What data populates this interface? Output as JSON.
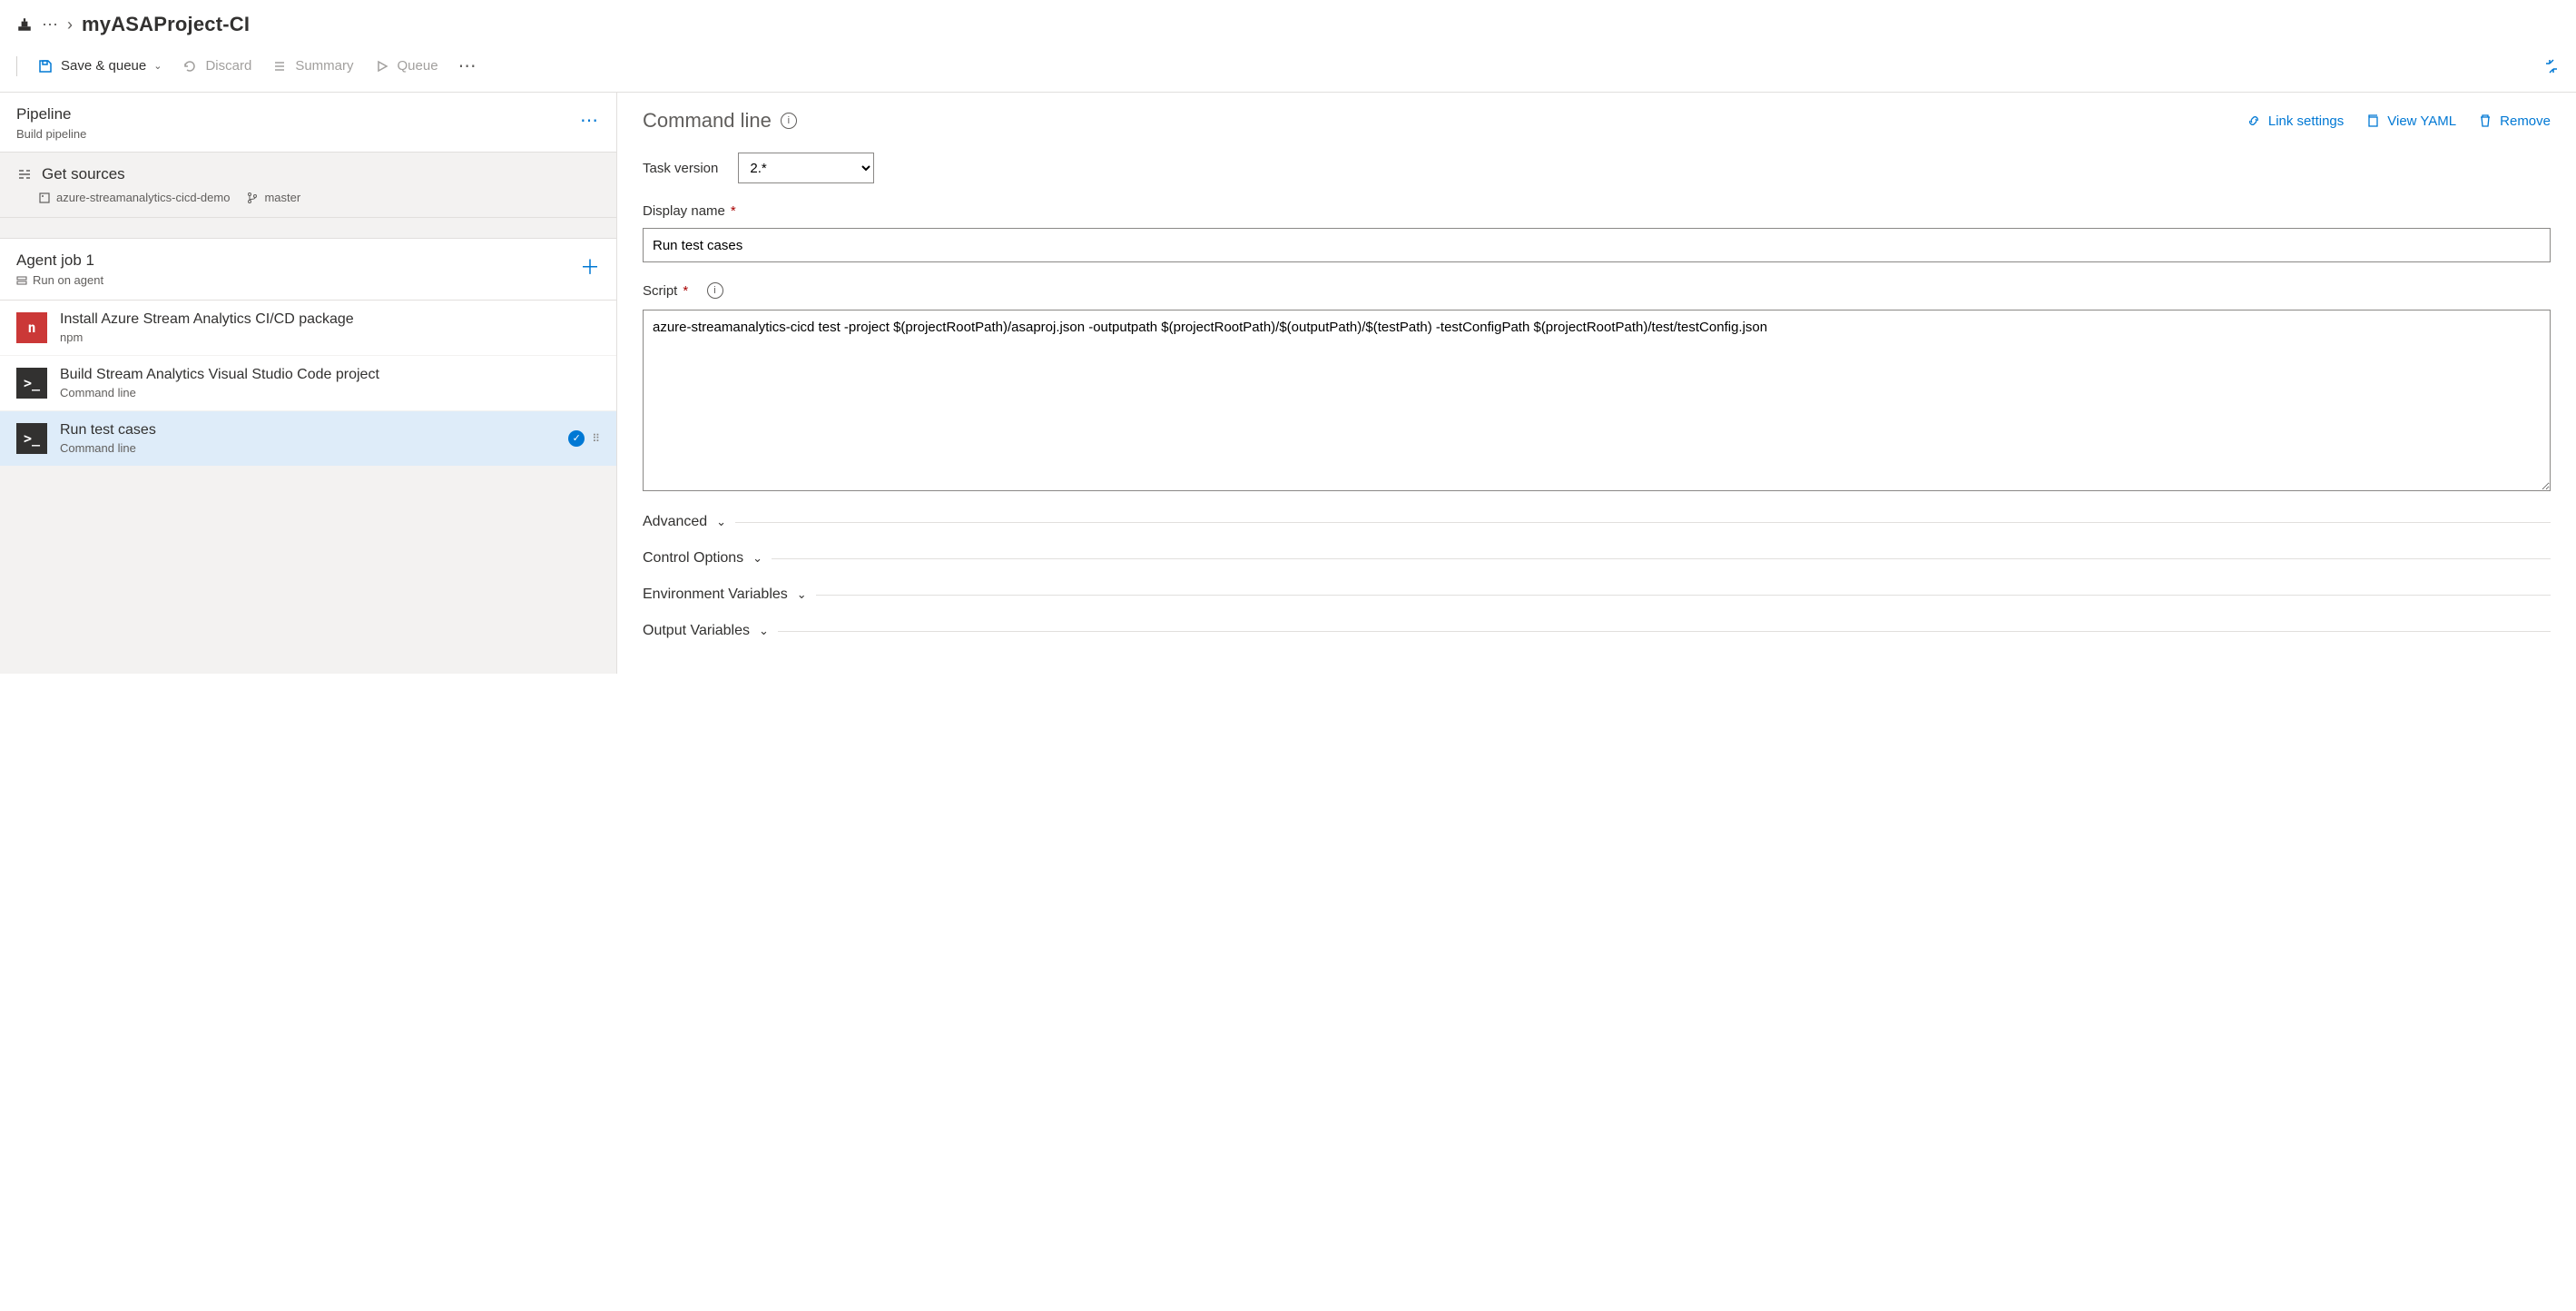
{
  "breadcrumb": {
    "title": "myASAProject-CI"
  },
  "toolbar": {
    "save_queue": "Save & queue",
    "discard": "Discard",
    "summary": "Summary",
    "queue": "Queue"
  },
  "pipeline": {
    "title": "Pipeline",
    "subtitle": "Build pipeline"
  },
  "sources": {
    "title": "Get sources",
    "repo": "azure-streamanalytics-cicd-demo",
    "branch": "master"
  },
  "agent": {
    "title": "Agent job 1",
    "subtitle": "Run on agent"
  },
  "tasks": [
    {
      "title": "Install Azure Stream Analytics CI/CD package",
      "sub": "npm",
      "icon": "npm",
      "glyph": "n"
    },
    {
      "title": "Build Stream Analytics Visual Studio Code project",
      "sub": "Command line",
      "icon": "cmd",
      "glyph": ">_"
    },
    {
      "title": "Run test cases",
      "sub": "Command line",
      "icon": "cmd",
      "glyph": ">_",
      "selected": true,
      "checked": true
    }
  ],
  "detail": {
    "header": "Command line",
    "link_settings": "Link settings",
    "view_yaml": "View YAML",
    "remove": "Remove",
    "task_version_label": "Task version",
    "task_version_value": "2.*",
    "display_name_label": "Display name",
    "display_name_value": "Run test cases",
    "script_label": "Script",
    "script_value": "azure-streamanalytics-cicd test -project $(projectRootPath)/asaproj.json -outputpath $(projectRootPath)/$(outputPath)/$(testPath) -testConfigPath $(projectRootPath)/test/testConfig.json",
    "sections": [
      "Advanced",
      "Control Options",
      "Environment Variables",
      "Output Variables"
    ]
  }
}
